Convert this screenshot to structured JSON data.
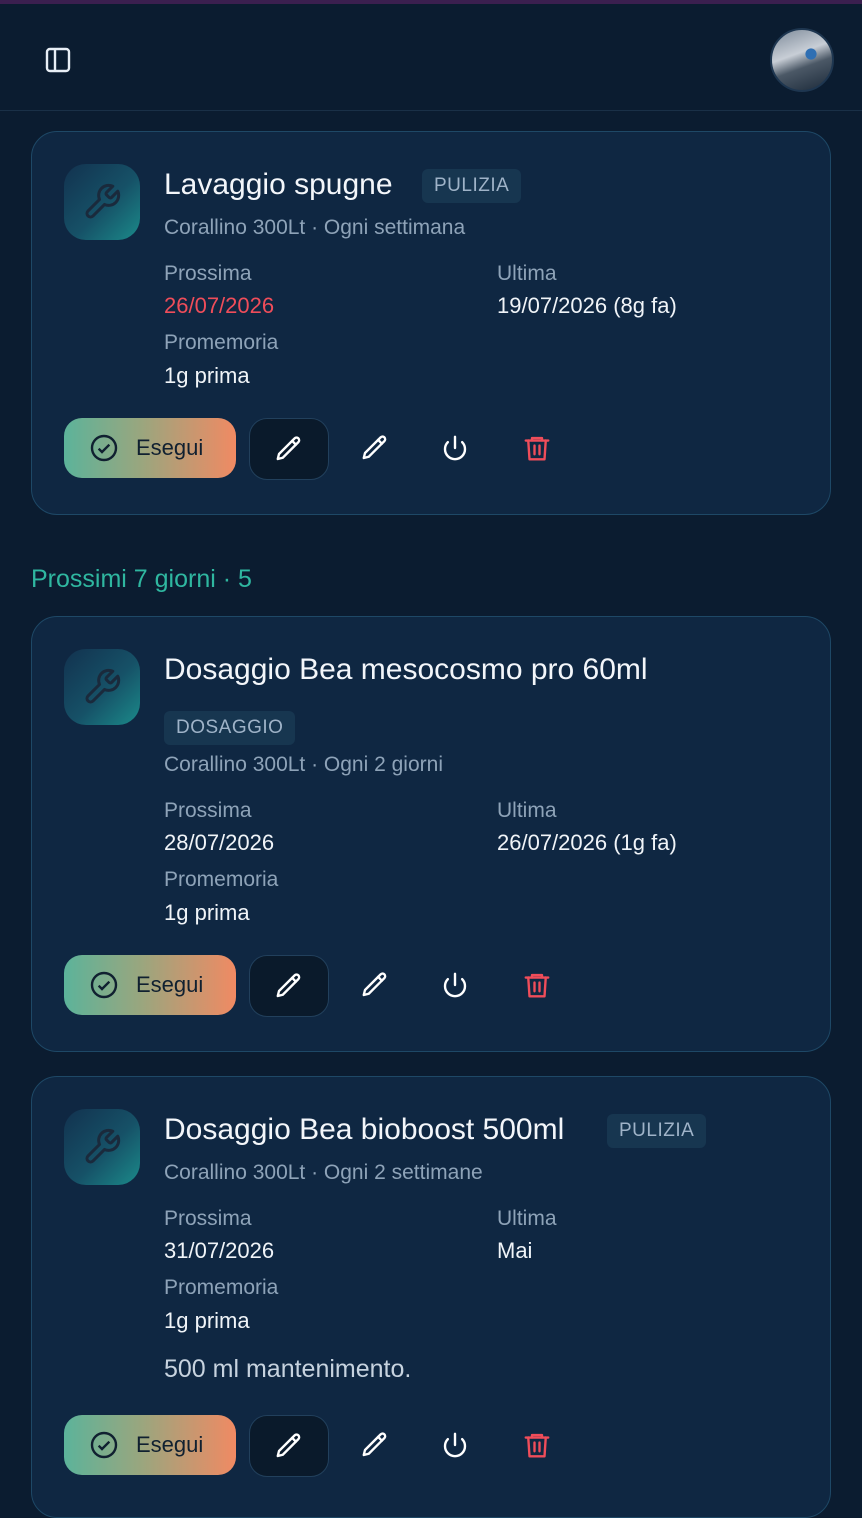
{
  "header": {
    "sidebar_icon": "sidebar-toggle-icon",
    "avatar_alt": "user avatar"
  },
  "colors": {
    "background": "#0b1c30",
    "card": "#0f2742",
    "accent_teal": "#2fb7a0",
    "danger": "#ef4d5a"
  },
  "section": {
    "title": "Prossimi 7 giorni · 5"
  },
  "cards": [
    {
      "title": "Lavaggio spugne",
      "badge": "PULIZIA",
      "subtitle": "Corallino 300Lt · Ogni settimana",
      "next_label": "Prossima",
      "next_value": "26/07/2026",
      "last_label": "Ultima",
      "last_value": "19/07/2026 (8g fa)",
      "reminder_label": "Promemoria",
      "reminder_value": "1g prima",
      "run_label": "Esegui"
    },
    {
      "title": "Dosaggio Bea mesocosmo pro 60ml",
      "badge": "DOSAGGIO",
      "subtitle": "Corallino 300Lt · Ogni 2 giorni",
      "next_label": "Prossima",
      "next_value": "28/07/2026",
      "last_label": "Ultima",
      "last_value": "26/07/2026 (1g fa)",
      "reminder_label": "Promemoria",
      "reminder_value": "1g prima",
      "run_label": "Esegui"
    },
    {
      "title": "Dosaggio Bea bioboost 500ml",
      "badge": "PULIZIA",
      "subtitle": "Corallino 300Lt · Ogni 2 settimane",
      "next_label": "Prossima",
      "next_value": "31/07/2026",
      "last_label": "Ultima",
      "last_value": "Mai",
      "reminder_label": "Promemoria",
      "reminder_value": "1g prima",
      "note": "500 ml mantenimento.",
      "run_label": "Esegui"
    }
  ]
}
